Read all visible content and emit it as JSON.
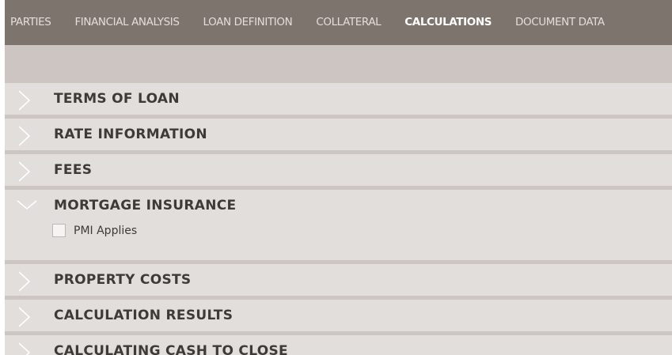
{
  "tabs": [
    {
      "label": "PARTIES"
    },
    {
      "label": "FINANCIAL ANALYSIS"
    },
    {
      "label": "LOAN DEFINITION"
    },
    {
      "label": "COLLATERAL"
    },
    {
      "label": "CALCULATIONS",
      "active": true
    },
    {
      "label": "DOCUMENT DATA"
    }
  ],
  "sections": [
    {
      "title": "TERMS OF LOAN",
      "expanded": false
    },
    {
      "title": "RATE INFORMATION",
      "expanded": false
    },
    {
      "title": "FEES",
      "expanded": false
    },
    {
      "title": "MORTGAGE INSURANCE",
      "expanded": true
    },
    {
      "title": "PROPERTY COSTS",
      "expanded": false
    },
    {
      "title": "CALCULATION RESULTS",
      "expanded": false
    },
    {
      "title": "CALCULATING CASH TO CLOSE",
      "expanded": false
    }
  ],
  "mortgage_insurance": {
    "pmi_label": "PMI Applies",
    "pmi_checked": false
  },
  "icons": {
    "collapsed": "chevron-right-icon",
    "expanded": "chevron-down-icon"
  },
  "colors": {
    "nav_bg": "#7d746e",
    "section_bg": "#e2dedb",
    "page_bg": "#cdc5c1",
    "text": "#3f3a38"
  }
}
